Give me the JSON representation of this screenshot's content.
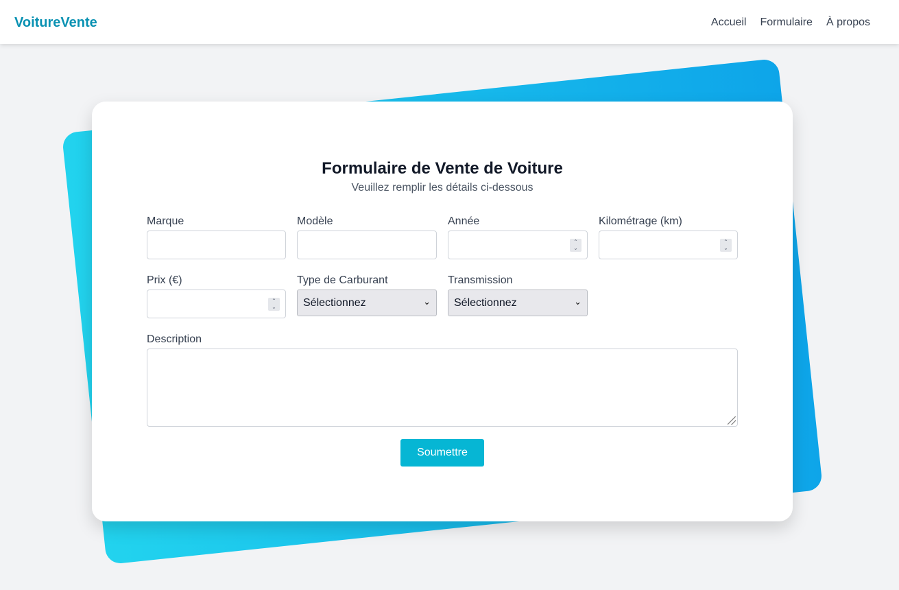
{
  "navbar": {
    "brand": "VoitureVente",
    "links": [
      "Accueil",
      "Formulaire",
      "À propos"
    ]
  },
  "form": {
    "title": "Formulaire de Vente de Voiture",
    "subtitle": "Veuillez remplir les détails ci-dessous",
    "fields": {
      "marque": {
        "label": "Marque",
        "value": ""
      },
      "modele": {
        "label": "Modèle",
        "value": ""
      },
      "annee": {
        "label": "Année",
        "value": ""
      },
      "kilometrage": {
        "label": "Kilométrage (km)",
        "value": ""
      },
      "prix": {
        "label": "Prix (€)",
        "value": ""
      },
      "carburant": {
        "label": "Type de Carburant",
        "selected": "Sélectionnez"
      },
      "transmission": {
        "label": "Transmission",
        "selected": "Sélectionnez"
      },
      "description": {
        "label": "Description",
        "value": ""
      }
    },
    "submit_label": "Soumettre"
  },
  "colors": {
    "brand": "#0891b2",
    "accent": "#06b6d4",
    "gradient_start": "#22d3ee",
    "gradient_end": "#0ea5e9",
    "page_bg": "#f2f3f5"
  }
}
